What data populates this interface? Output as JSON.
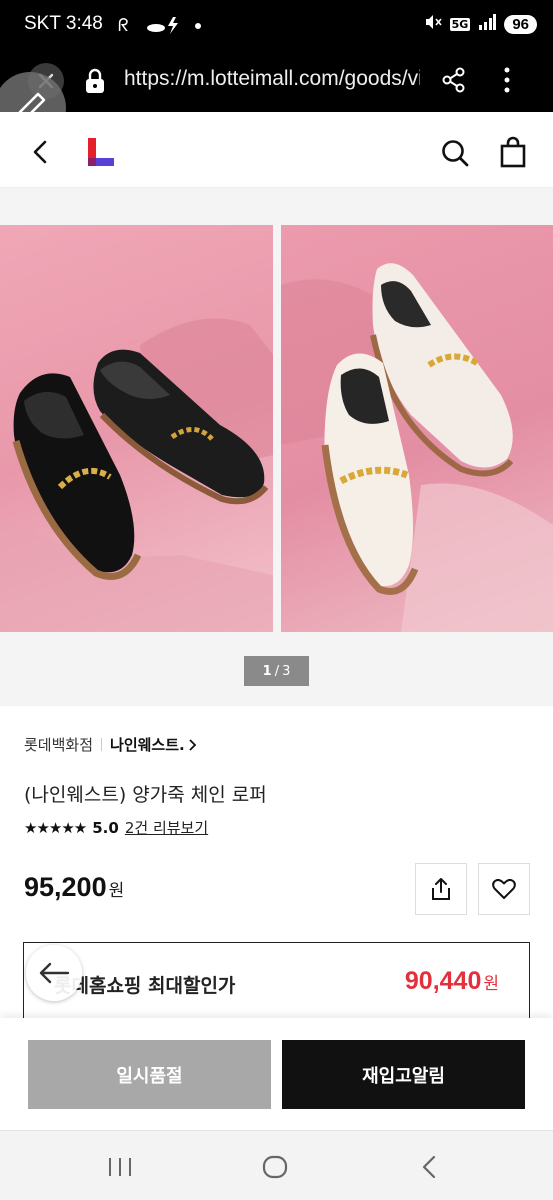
{
  "status_bar": {
    "carrier": "SKT",
    "time": "3:48",
    "network": "5G",
    "battery": "96"
  },
  "browser": {
    "url": "https://m.lotteimall.com/goods/viewGoodsDetail.lotte"
  },
  "gallery": {
    "current_page": "1",
    "separator": "/",
    "total_pages": "3"
  },
  "product": {
    "store": "롯데백화점",
    "brand": "나인웨스트.",
    "title": "(나인웨스트) 양가죽 체인 로퍼",
    "stars": "★★★★★",
    "rating": "5.0",
    "review_link": "2건 리뷰보기",
    "price": "95,200",
    "currency": "원"
  },
  "discount": {
    "label": "롯데홈쇼핑 최대할인가",
    "price": "90,440",
    "currency": "원",
    "color": "#e3303d"
  },
  "actions": {
    "soldout_label": "일시품절",
    "restock_label": "재입고알림"
  },
  "icons": {
    "brand_logo": "lotte-L-logo",
    "header": [
      "back-chevron-icon",
      "search-icon",
      "shopping-bag-icon"
    ],
    "product": [
      "share-icon",
      "heart-icon"
    ],
    "system_nav": [
      "recent-apps-icon",
      "home-icon",
      "back-icon"
    ]
  }
}
